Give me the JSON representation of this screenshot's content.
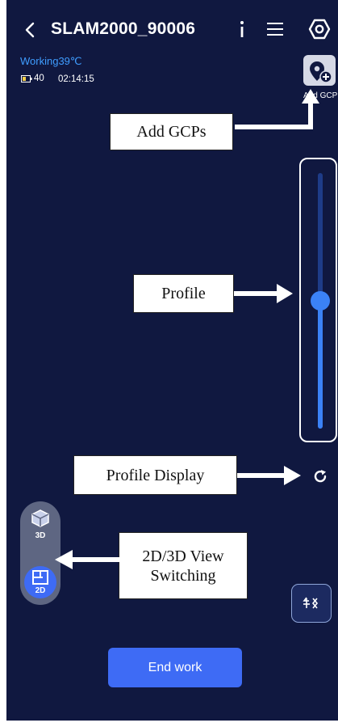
{
  "header": {
    "title": "SLAM2000_90006",
    "back_icon": "chevron-left-icon",
    "info_icon": "info-icon",
    "menu_icon": "menu-icon",
    "settings_icon": "settings-icon"
  },
  "status": {
    "working_text": "Working39℃",
    "battery_level": "40",
    "elapsed_time": "02:14:15"
  },
  "gcp": {
    "label": "Add GCP",
    "icon": "add-location-icon"
  },
  "profile_slider": {
    "level_fraction": 0.5
  },
  "view_switch": {
    "label_3d": "3D",
    "label_2d": "2D",
    "selected": "2D"
  },
  "end_button_label": "End work",
  "callouts": {
    "add_gcps": "Add GCPs",
    "profile": "Profile",
    "profile_display": "Profile Display",
    "view_switching_line1": "2D/3D View",
    "view_switching_line2": "Switching"
  },
  "colors": {
    "background": "#101840",
    "accent": "#3e6bf5",
    "status_text": "#3f9dff",
    "slider": "#3b82f6"
  }
}
